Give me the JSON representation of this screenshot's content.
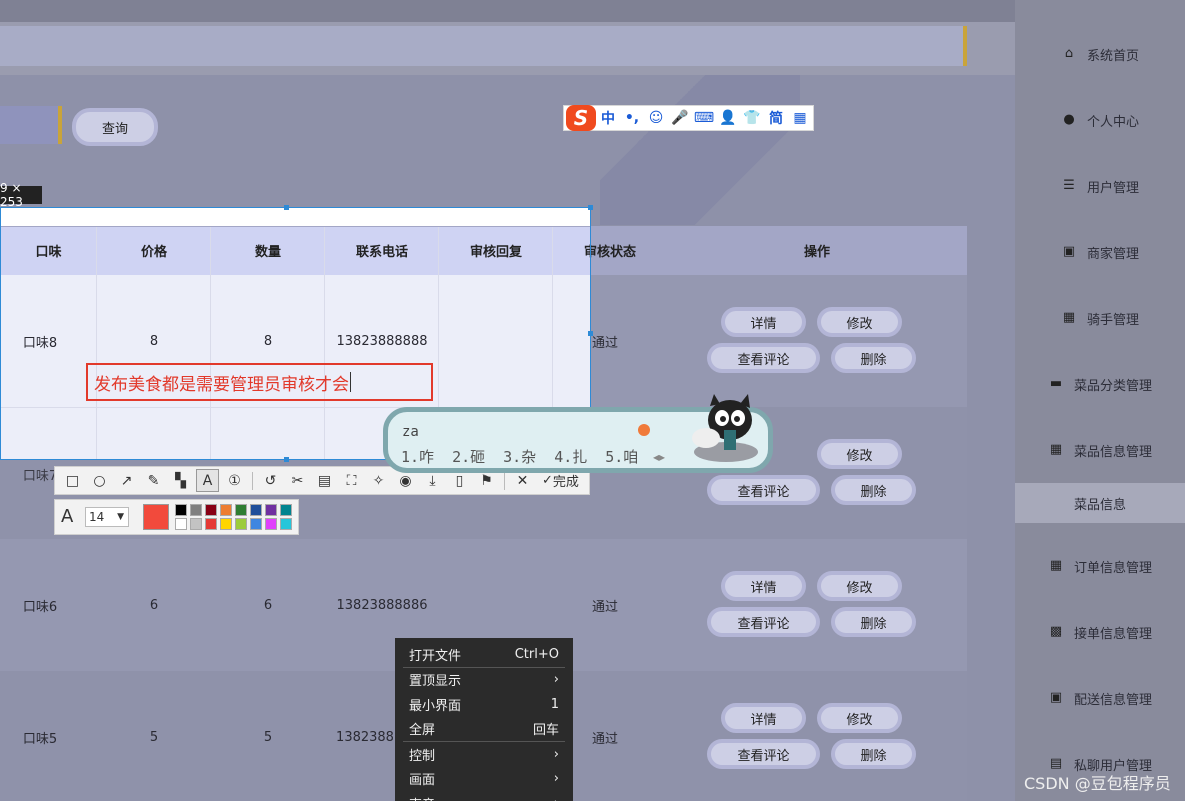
{
  "sidebar": {
    "items": [
      {
        "label": "系统首页",
        "icon": "home-icon",
        "glyph": "⌂"
      },
      {
        "label": "个人中心",
        "icon": "person-icon",
        "glyph": "●"
      },
      {
        "label": "用户管理",
        "icon": "sliders-icon",
        "glyph": "☰"
      },
      {
        "label": "商家管理",
        "icon": "clipboard-x-icon",
        "glyph": "▣"
      },
      {
        "label": "骑手管理",
        "icon": "grid-icon",
        "glyph": "▦"
      },
      {
        "label": "菜品分类管理",
        "icon": "briefcase-icon",
        "glyph": "▬"
      },
      {
        "label": "菜品信息管理",
        "icon": "grid-icon",
        "glyph": "▦"
      },
      {
        "label": "菜品信息",
        "icon": "",
        "glyph": ""
      },
      {
        "label": "订单信息管理",
        "icon": "grid-icon",
        "glyph": "▦"
      },
      {
        "label": "接单信息管理",
        "icon": "apps-icon",
        "glyph": "▩"
      },
      {
        "label": "配送信息管理",
        "icon": "clipboard-check-icon",
        "glyph": "▣"
      },
      {
        "label": "私聊用户管理",
        "icon": "document-icon",
        "glyph": "▤"
      }
    ]
  },
  "search": {
    "query_label": "查询"
  },
  "table": {
    "headers": [
      "口味",
      "价格",
      "数量",
      "联系电话",
      "审核回复",
      "审核状态",
      "操作"
    ],
    "rows": [
      {
        "taste": "口味8",
        "price": "8",
        "qty": "8",
        "phone": "13823888888",
        "reply": "",
        "status": "通过"
      },
      {
        "taste": "口味7",
        "price": "",
        "qty": "",
        "phone": "",
        "reply": "",
        "status": ""
      },
      {
        "taste": "口味6",
        "price": "6",
        "qty": "6",
        "phone": "13823888886",
        "reply": "",
        "status": "通过"
      },
      {
        "taste": "口味5",
        "price": "5",
        "qty": "5",
        "phone": "1382388",
        "reply": "",
        "status": "通过"
      }
    ],
    "actions": {
      "detail": "详情",
      "edit": "修改",
      "reviews": "查看评论",
      "delete": "删除"
    }
  },
  "screenshot_tool": {
    "size_label": "9 × 253",
    "annotation_text": "发布美食都是需要管理员审核才会",
    "done_label": "完成",
    "font_size": "14",
    "active_color": "#f24a3c",
    "palette": [
      "#000000",
      "#7f7f7f",
      "#880015",
      "#ed7d31",
      "#2e7d32",
      "#1f4e9a",
      "#7030a0",
      "#00838f",
      "#ffffff",
      "#c3c3c3",
      "#e53935",
      "#ffd500",
      "#9ccc3c",
      "#3f86e0",
      "#e040fb",
      "#26c6da"
    ]
  },
  "ime": {
    "toolbar": [
      "中",
      "•,",
      "☺",
      "🎤",
      "⌨",
      "👤",
      "👕",
      "简",
      "▦"
    ],
    "input": "za",
    "candidates": [
      "1.咋",
      "2.砸",
      "3.杂",
      "4.扎",
      "5.咱"
    ]
  },
  "context_menu": {
    "items": [
      {
        "label": "打开文件",
        "shortcut": "Ctrl+O",
        "arrow": false
      },
      {
        "label": "置顶显示",
        "shortcut": "",
        "arrow": true
      },
      {
        "label": "最小界面",
        "shortcut": "1",
        "arrow": false
      },
      {
        "label": "全屏",
        "shortcut": "回车",
        "arrow": false
      },
      {
        "label": "控制",
        "shortcut": "",
        "arrow": true
      },
      {
        "label": "画面",
        "shortcut": "",
        "arrow": true
      },
      {
        "label": "声音",
        "shortcut": "",
        "arrow": true
      }
    ]
  },
  "watermark": "CSDN @豆包程序员"
}
